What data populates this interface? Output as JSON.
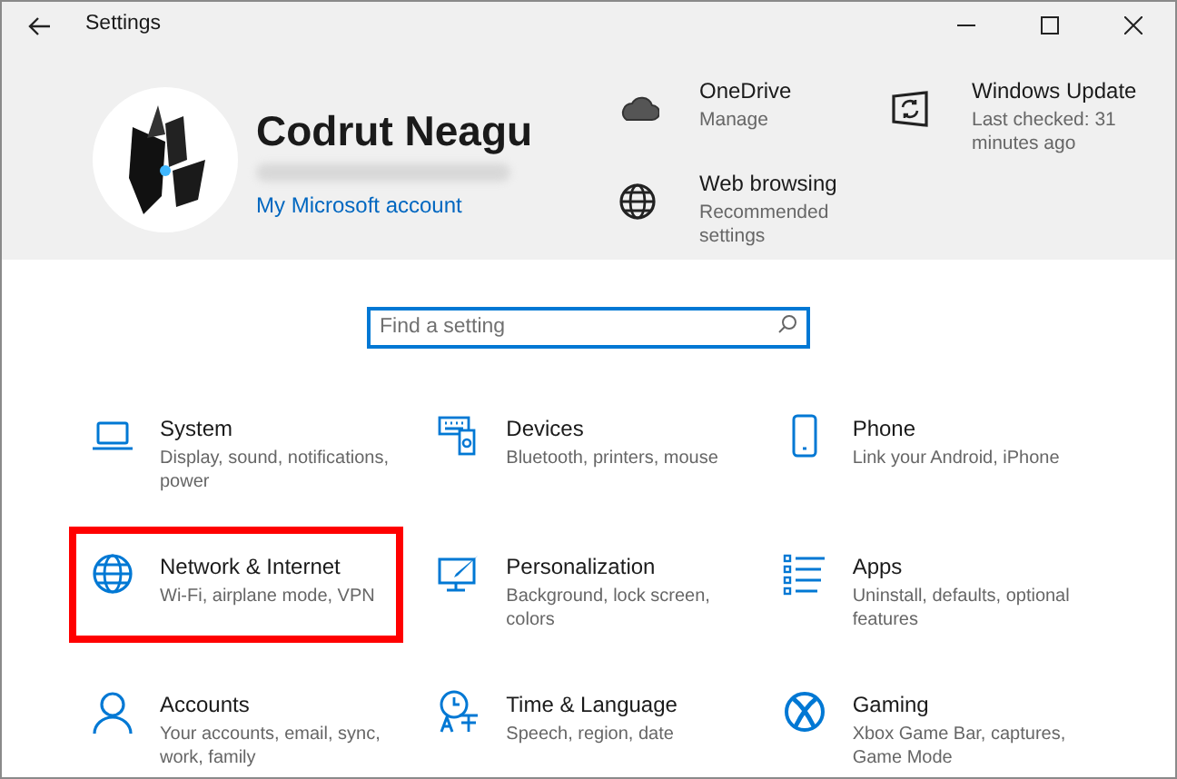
{
  "window": {
    "title": "Settings"
  },
  "profile": {
    "name": "Codrut Neagu",
    "link": "My Microsoft account"
  },
  "quick_links": [
    {
      "kind": "onedrive",
      "title": "OneDrive",
      "subtitle": "Manage"
    },
    {
      "kind": "update",
      "title": "Windows Update",
      "subtitle": "Last checked: 31 minutes ago"
    },
    {
      "kind": "web",
      "title": "Web browsing",
      "subtitle": "Recommended settings"
    }
  ],
  "search": {
    "placeholder": "Find a setting"
  },
  "categories": [
    {
      "kind": "system",
      "title": "System",
      "subtitle": "Display, sound, notifications, power",
      "highlighted": false
    },
    {
      "kind": "devices",
      "title": "Devices",
      "subtitle": "Bluetooth, printers, mouse",
      "highlighted": false
    },
    {
      "kind": "phone",
      "title": "Phone",
      "subtitle": "Link your Android, iPhone",
      "highlighted": false
    },
    {
      "kind": "network",
      "title": "Network & Internet",
      "subtitle": "Wi-Fi, airplane mode, VPN",
      "highlighted": true
    },
    {
      "kind": "personalization",
      "title": "Personalization",
      "subtitle": "Background, lock screen, colors",
      "highlighted": false
    },
    {
      "kind": "apps",
      "title": "Apps",
      "subtitle": "Uninstall, defaults, optional features",
      "highlighted": false
    },
    {
      "kind": "accounts",
      "title": "Accounts",
      "subtitle": "Your accounts, email, sync, work, family",
      "highlighted": false
    },
    {
      "kind": "time",
      "title": "Time & Language",
      "subtitle": "Speech, region, date",
      "highlighted": false
    },
    {
      "kind": "gaming",
      "title": "Gaming",
      "subtitle": "Xbox Game Bar, captures, Game Mode",
      "highlighted": false
    }
  ]
}
